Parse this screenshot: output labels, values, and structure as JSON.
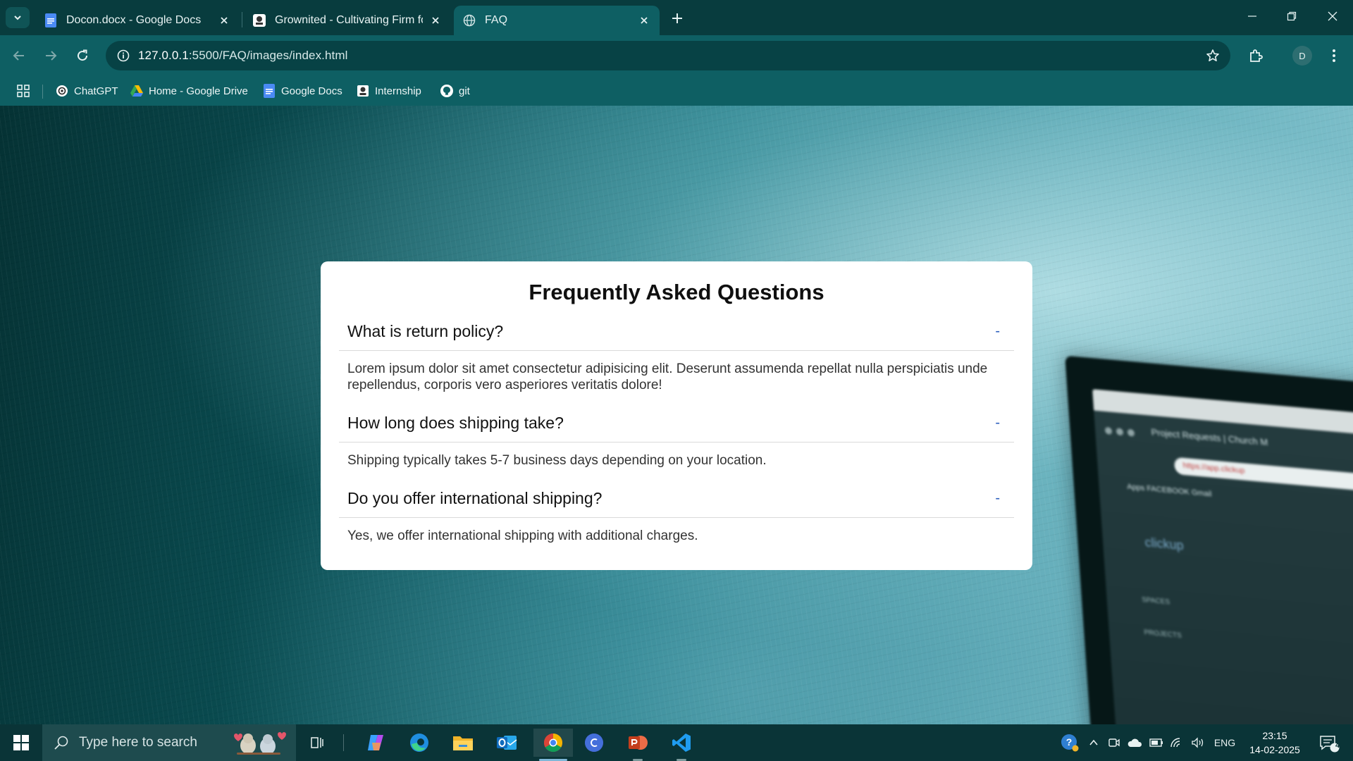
{
  "browser": {
    "tabs": [
      {
        "title": "Docon.docx - Google Docs",
        "active": false
      },
      {
        "title": "Grownited - Cultivating Firm for",
        "active": false
      },
      {
        "title": "FAQ",
        "active": true
      }
    ],
    "url_host": "127.0.0.1",
    "url_rest": ":5500/FAQ/images/index.html",
    "profile_initial": "D",
    "bookmarks": [
      "ChatGPT",
      "Home - Google Drive",
      "Google Docs",
      "Internship",
      "git"
    ]
  },
  "faq": {
    "title": "Frequently Asked Questions",
    "items": [
      {
        "question": "What is return policy?",
        "toggle": "-",
        "answer": "Lorem ipsum dolor sit amet consectetur adipisicing elit. Deserunt assumenda repellat nulla perspiciatis unde repellendus, corporis vero asperiores veritatis dolore!"
      },
      {
        "question": "How long does shipping take?",
        "toggle": "-",
        "answer": "Shipping typically takes 5-7 business days depending on your location."
      },
      {
        "question": "Do you offer international shipping?",
        "toggle": "-",
        "answer": "Yes, we offer international shipping with additional charges."
      }
    ]
  },
  "background_laptop": {
    "tab": "Project Requests | Church M",
    "url": "https://app.clickup",
    "bookmarks": "Apps  FACEBOOK  Gmail",
    "logo": "clickup",
    "sidebar": [
      "SPACES",
      "PROJECTS"
    ]
  },
  "taskbar": {
    "search_placeholder": "Type here to search",
    "language": "ENG",
    "time": "23:15",
    "date": "14-02-2025",
    "notification_count": "4"
  },
  "colors": {
    "chrome_dark": "#083c3e",
    "chrome_toolbar": "#0e5f63",
    "accent_toggle": "#2a5dbd",
    "taskbar": "#0a3437"
  }
}
